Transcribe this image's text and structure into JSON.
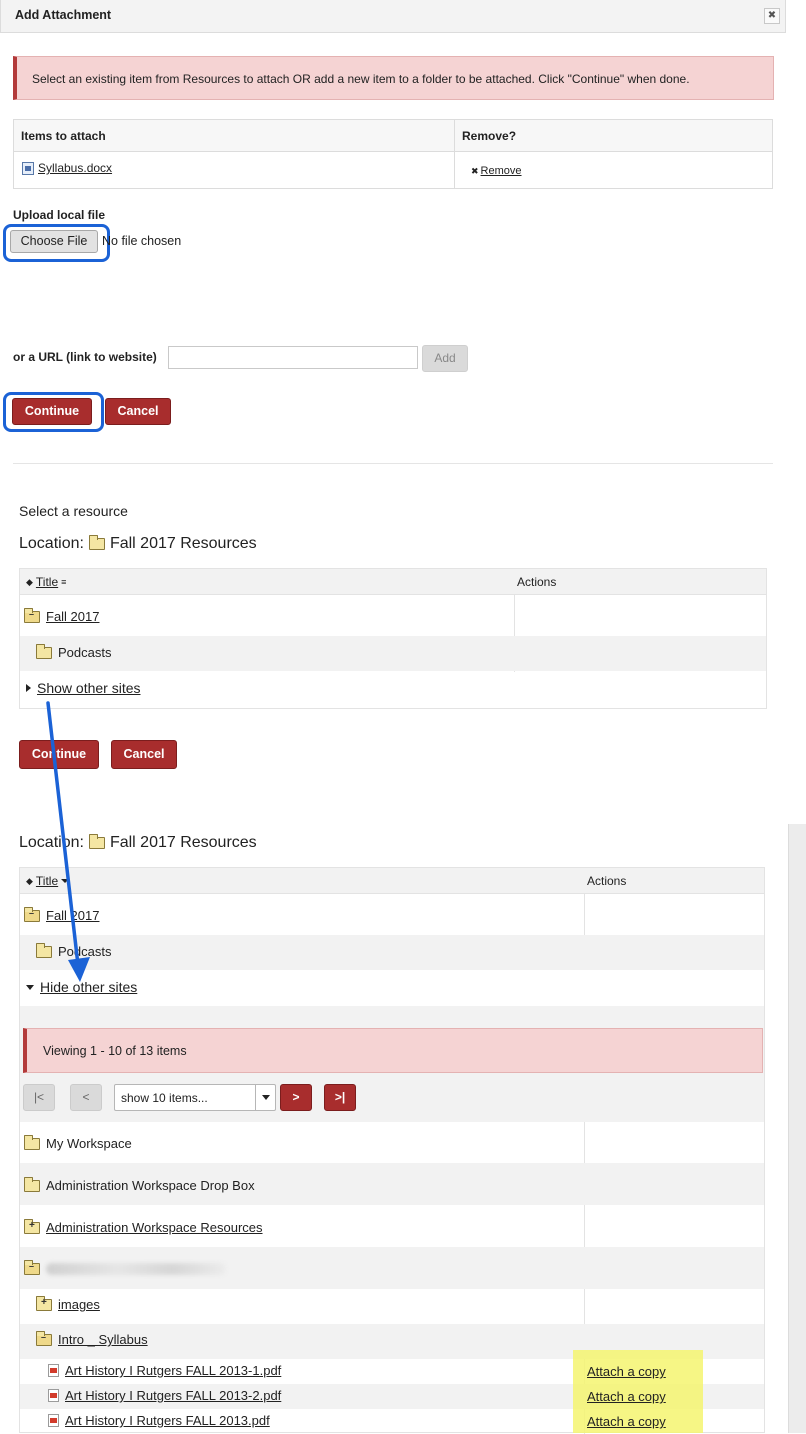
{
  "dialog": {
    "title": "Add Attachment",
    "close_label": "✖",
    "instructions": "Select an existing item from Resources to attach OR add a new item to a folder to be attached. Click \"Continue\" when done."
  },
  "attachments": {
    "col_items": "Items to attach",
    "col_remove": "Remove?",
    "rows": [
      {
        "file": "Syllabus.docx",
        "remove_label": " Remove",
        "remove_icon": "✖"
      }
    ]
  },
  "upload": {
    "label": "Upload local file",
    "choose_button": "Choose File",
    "status": "No file chosen"
  },
  "url": {
    "label": "or a URL (link to website)",
    "value": "",
    "add_button": "Add"
  },
  "buttons": {
    "continue": "Continue",
    "cancel": "Cancel"
  },
  "resource_picker": {
    "heading": "Select a resource",
    "location_prefix": "Location:",
    "location_name": "Fall 2017 Resources",
    "col_title": " Title",
    "col_actions": "Actions",
    "rows": [
      {
        "label": " Fall 2017"
      },
      {
        "label": "Podcasts"
      }
    ],
    "show_other": " Show other sites"
  },
  "expanded_picker": {
    "location_prefix": "Location:",
    "location_name": "Fall 2017 Resources",
    "col_title": " Title",
    "col_actions": "Actions",
    "rows": [
      {
        "label": " Fall 2017"
      },
      {
        "label": "Podcasts"
      }
    ],
    "hide_other": " Hide other sites",
    "viewing": "Viewing 1 - 10 of 13 items",
    "pager": {
      "first": "|<",
      "prev": "<",
      "page_size": "show 10 items...",
      "next": ">",
      "last": ">|"
    },
    "sites": [
      {
        "label": "My Workspace"
      },
      {
        "label": "Administration Workspace Drop Box"
      },
      {
        "label": " Administration Workspace Resources"
      },
      {
        "label": " images"
      },
      {
        "label": " Intro _ Syllabus"
      }
    ],
    "files": [
      {
        "name": " Art History I Rutgers FALL 2013-1.pdf",
        "action": "Attach a copy"
      },
      {
        "name": " Art History I Rutgers FALL 2013-2.pdf",
        "action": "Attach a copy"
      },
      {
        "name": " Art History I Rutgers FALL 2013.pdf",
        "action": "Attach a copy"
      }
    ]
  },
  "colors": {
    "primary_button": "#a82d2d",
    "alert_bg": "#f5d3d3",
    "focus_outline": "#1b62d6",
    "highlight": "#f5f570"
  }
}
